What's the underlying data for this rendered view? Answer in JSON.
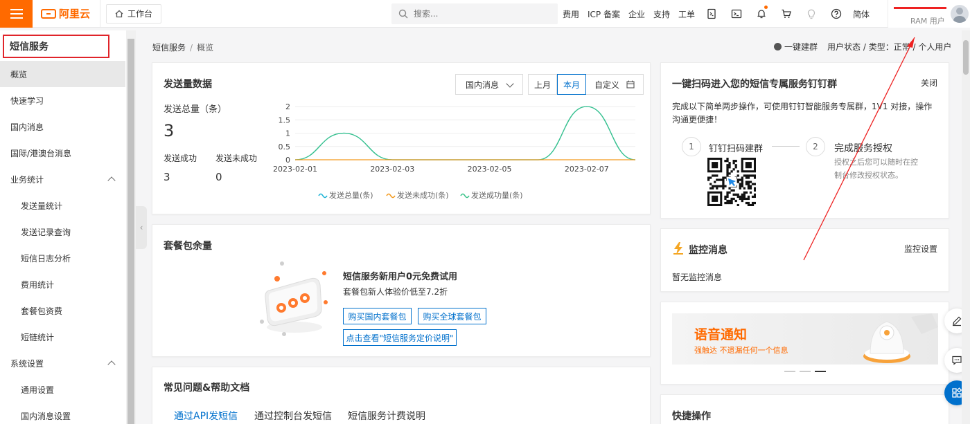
{
  "header": {
    "logo_text": "阿里云",
    "workbench_label": "工作台",
    "search_placeholder": "搜索...",
    "links": [
      "费用",
      "ICP 备案",
      "企业",
      "支持",
      "工单"
    ],
    "lang": "简体",
    "user_role": "RAM 用户"
  },
  "sidebar": {
    "title": "短信服务",
    "items": [
      {
        "label": "概览",
        "active": true
      },
      {
        "label": "快速学习"
      },
      {
        "label": "国内消息"
      },
      {
        "label": "国际/港澳台消息"
      },
      {
        "label": "业务统计",
        "expandable": true
      },
      {
        "label": "发送量统计",
        "sub": true
      },
      {
        "label": "发送记录查询",
        "sub": true
      },
      {
        "label": "短信日志分析",
        "sub": true
      },
      {
        "label": "费用统计",
        "sub": true
      },
      {
        "label": "套餐包资费",
        "sub": true
      },
      {
        "label": "短链统计",
        "sub": true
      },
      {
        "label": "系统设置",
        "expandable": true
      },
      {
        "label": "通用设置",
        "sub": true
      },
      {
        "label": "国内消息设置",
        "sub": true
      }
    ]
  },
  "breadcrumb": {
    "root": "短信服务",
    "sep": "/",
    "current": "概览"
  },
  "status": {
    "group_link": "一键建群",
    "user_status": "用户状态 / 类型：正常 / 个人用户"
  },
  "send_card": {
    "title": "发送量数据",
    "select_value": "国内消息",
    "ranges": [
      "上月",
      "本月",
      "自定义"
    ],
    "total_label": "发送总量（条）",
    "total_value": "3",
    "success_label": "发送成功",
    "success_value": "3",
    "fail_label": "发送未成功",
    "fail_value": "0"
  },
  "chart_data": {
    "type": "line",
    "x": [
      "2023-02-01",
      "2023-02-02",
      "2023-02-03",
      "2023-02-04",
      "2023-02-05",
      "2023-02-06",
      "2023-02-07",
      "2023-02-08"
    ],
    "x_tick_labels": [
      "2023-02-01",
      "2023-02-03",
      "2023-02-05",
      "2023-02-07"
    ],
    "y_ticks": [
      "0",
      "0.5",
      "1",
      "1.5",
      "2"
    ],
    "ylim": [
      0,
      2
    ],
    "series": [
      {
        "name": "发送总量(条)",
        "color": "#1fb3d6",
        "values": [
          0,
          1,
          0,
          0,
          0,
          0,
          2,
          0
        ]
      },
      {
        "name": "发送未成功(条)",
        "color": "#f39a1e",
        "values": [
          0,
          0,
          0,
          0,
          0,
          0,
          0,
          0
        ]
      },
      {
        "name": "发送成功量(条)",
        "color": "#3cc38a",
        "values": [
          0,
          1,
          0,
          0,
          0,
          0,
          2,
          0
        ]
      }
    ]
  },
  "package_card": {
    "title": "套餐包余量",
    "promo_title": "短信服务新用户0元免费试用",
    "promo_sub": "套餐包新人体验价低至7.2折",
    "btn_domestic": "购买国内套餐包",
    "btn_global": "购买全球套餐包",
    "btn_pricing": "点击查看\"短信服务定价说明\""
  },
  "faq_card": {
    "title": "常见问题&帮助文档",
    "tabs": [
      "通过API发短信",
      "通过控制台发短信",
      "短信服务计费说明"
    ]
  },
  "dingtalk_card": {
    "title": "一键扫码进入您的短信专属服务钉钉群",
    "close": "关闭",
    "desc": "完成以下简单两步操作，可使用钉钉智能服务专属群，1V1 对接，操作沟通更便捷！",
    "step1_num": "1",
    "step1_label": "钉钉扫码建群",
    "step2_num": "2",
    "step2_label": "完成服务授权",
    "step2_desc": "授权之后您可以随时在控制台修改授权状态。"
  },
  "monitor_card": {
    "title": "监控消息",
    "settings": "监控设置",
    "empty": "暂无监控消息"
  },
  "banner": {
    "title": "语音通知",
    "subtitle": "强触达 不遗漏任何一个信息"
  },
  "quick_card": {
    "title": "快捷操作"
  }
}
